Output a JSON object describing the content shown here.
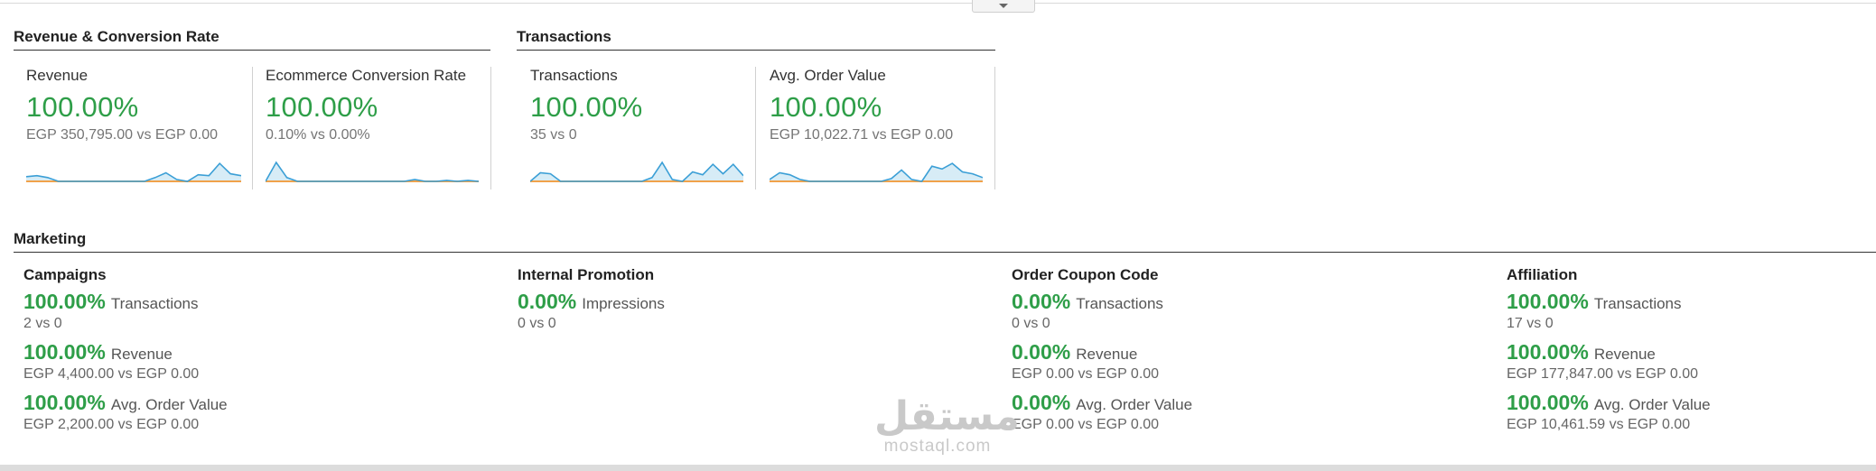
{
  "sections": {
    "revenue_conversion": {
      "title": "Revenue & Conversion Rate"
    },
    "transactions": {
      "title": "Transactions"
    },
    "marketing": {
      "title": "Marketing"
    }
  },
  "kpis": [
    {
      "label": "Revenue",
      "pct": "100.00%",
      "compare": "EGP 350,795.00 vs EGP 0.00",
      "spark": [
        0.25,
        0.3,
        0.2,
        0,
        0,
        0,
        0,
        0,
        0,
        0,
        0,
        0,
        0.2,
        0.45,
        0.1,
        0,
        0.35,
        0.3,
        0.95,
        0.4,
        0.3
      ]
    },
    {
      "label": "Ecommerce Conversion Rate",
      "pct": "100.00%",
      "compare": "0.10% vs 0.00%",
      "spark": [
        0,
        1,
        0.2,
        0,
        0,
        0,
        0,
        0,
        0,
        0,
        0,
        0,
        0,
        0,
        0.1,
        0,
        0,
        0.05,
        0,
        0.05,
        0
      ]
    },
    {
      "label": "Transactions",
      "pct": "100.00%",
      "compare": "35 vs 0",
      "spark": [
        0,
        0.45,
        0.4,
        0,
        0,
        0,
        0,
        0,
        0,
        0,
        0,
        0,
        0.2,
        1,
        0.1,
        0,
        0.5,
        0.35,
        0.9,
        0.4,
        0.9,
        0.3
      ]
    },
    {
      "label": "Avg. Order Value",
      "pct": "100.00%",
      "compare": "EGP 10,022.71 vs EGP 0.00",
      "spark": [
        0.1,
        0.45,
        0.35,
        0.1,
        0,
        0,
        0,
        0,
        0,
        0,
        0,
        0,
        0.15,
        0.6,
        0.1,
        0,
        0.8,
        0.65,
        0.95,
        0.5,
        0.4,
        0.2
      ]
    }
  ],
  "marketing": [
    {
      "head": "Campaigns",
      "metrics": [
        {
          "pct": "100.00%",
          "name": "Transactions",
          "compare": "2 vs 0"
        },
        {
          "pct": "100.00%",
          "name": "Revenue",
          "compare": "EGP 4,400.00 vs EGP 0.00"
        },
        {
          "pct": "100.00%",
          "name": "Avg. Order Value",
          "compare": "EGP 2,200.00 vs EGP 0.00"
        }
      ]
    },
    {
      "head": "Internal Promotion",
      "metrics": [
        {
          "pct": "0.00%",
          "name": "Impressions",
          "compare": "0 vs 0"
        }
      ]
    },
    {
      "head": "Order Coupon Code",
      "metrics": [
        {
          "pct": "0.00%",
          "name": "Transactions",
          "compare": "0 vs 0"
        },
        {
          "pct": "0.00%",
          "name": "Revenue",
          "compare": "EGP 0.00 vs EGP 0.00"
        },
        {
          "pct": "0.00%",
          "name": "Avg. Order Value",
          "compare": "EGP 0.00 vs EGP 0.00"
        }
      ]
    },
    {
      "head": "Affiliation",
      "metrics": [
        {
          "pct": "100.00%",
          "name": "Transactions",
          "compare": "17 vs 0"
        },
        {
          "pct": "100.00%",
          "name": "Revenue",
          "compare": "EGP 177,847.00 vs EGP 0.00"
        },
        {
          "pct": "100.00%",
          "name": "Avg. Order Value",
          "compare": "EGP 10,461.59 vs EGP 0.00"
        }
      ]
    }
  ],
  "watermark": {
    "arabic": "مستقل",
    "latin": "mostaql.com"
  },
  "colors": {
    "green": "#2e9e48",
    "spark_line": "#3b9fd6",
    "spark_fill": "#d7ecf6",
    "baseline": "#f0a24a"
  }
}
